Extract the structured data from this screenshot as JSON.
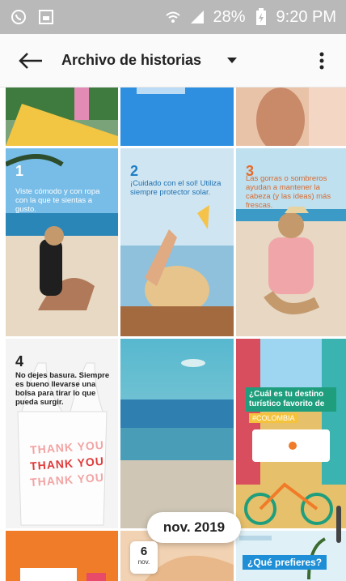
{
  "status": {
    "battery": "28%",
    "time": "9:20 PM",
    "icons": [
      "whatsapp-icon",
      "image-icon",
      "wifi-icon",
      "signal-icon",
      "battery-icon"
    ]
  },
  "appbar": {
    "title": "Archivo de historias",
    "back_icon": "arrow-left-icon",
    "dropdown_icon": "caret-down-icon",
    "menu_icon": "more-vert-icon"
  },
  "stories": [
    {
      "number": "1",
      "caption": "Viste cómodo y con ropa con la que te sientas a gusto."
    },
    {
      "number": "2",
      "caption": "¡Cuidado con el sol! Utiliza siempre protector solar."
    },
    {
      "number": "3",
      "caption": "Las gorras o sombreros ayudan a mantener la cabeza (y las ideas) más frescas."
    },
    {
      "number": "4",
      "caption": "No dejes basura. Siempre es bueno llevarse una bolsa para tirar lo que pueda surgir."
    },
    {
      "bag_text": "THANK YOU"
    },
    {
      "overlay": "¿Cuál es tu destino turístico favorito de",
      "tag": "#COLOMBIA"
    },
    {
      "overlay": "¿Qué prefieres?"
    }
  ],
  "month_pill": "nov. 2019",
  "day_badge": {
    "day": "6",
    "month": "nov."
  },
  "colors": {
    "statusbar": "#b9b9b9",
    "appbar": "#fafafa",
    "accent_orange": "#f07b28",
    "sea": "#2f7fb0"
  }
}
